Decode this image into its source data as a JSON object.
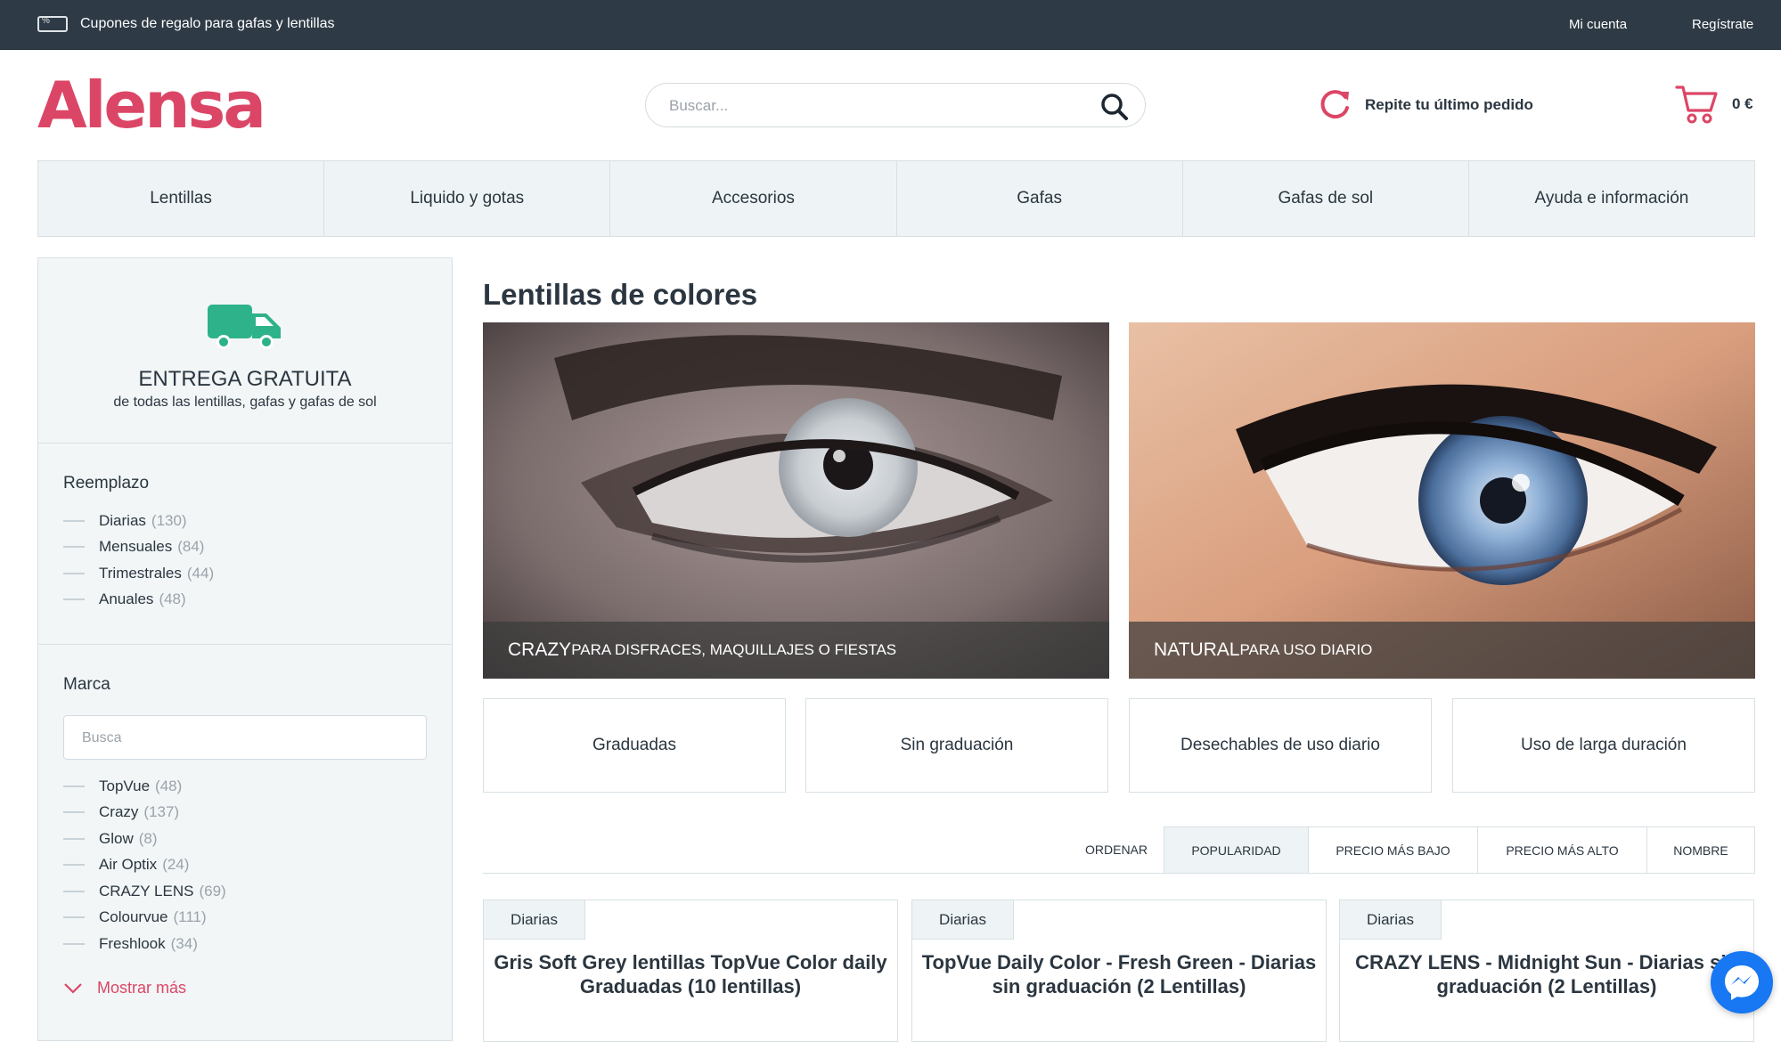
{
  "topbar": {
    "coupon_text": "Cupones de regalo para gafas y lentillas",
    "my_account": "Mi cuenta",
    "register": "Regístrate"
  },
  "header": {
    "logo": "Alensa",
    "search_placeholder": "Buscar...",
    "reorder_label": "Repite tu último pedido",
    "cart_total": "0 €"
  },
  "nav": {
    "items": [
      "Lentillas",
      "Liquido y gotas",
      "Accesorios",
      "Gafas",
      "Gafas de sol",
      "Ayuda e información"
    ]
  },
  "sidebar": {
    "delivery_title": "ENTREGA GRATUITA",
    "delivery_sub": "de todas las lentillas, gafas y gafas de sol",
    "replacement": {
      "title": "Reemplazo",
      "items": [
        {
          "label": "Diarias",
          "count": "(130)"
        },
        {
          "label": "Mensuales",
          "count": "(84)"
        },
        {
          "label": "Trimestrales",
          "count": "(44)"
        },
        {
          "label": "Anuales",
          "count": "(48)"
        }
      ]
    },
    "brand": {
      "title": "Marca",
      "search_placeholder": "Busca",
      "items": [
        {
          "label": "TopVue",
          "count": "(48)"
        },
        {
          "label": "Crazy",
          "count": "(137)"
        },
        {
          "label": "Glow",
          "count": "(8)"
        },
        {
          "label": "Air Optix",
          "count": "(24)"
        },
        {
          "label": "CRAZY LENS",
          "count": "(69)"
        },
        {
          "label": "Colourvue",
          "count": "(111)"
        },
        {
          "label": "Freshlook",
          "count": "(34)"
        }
      ],
      "show_more": "Mostrar más"
    }
  },
  "main": {
    "title": "Lentillas de colores",
    "banners": [
      {
        "main": "CRAZY",
        "sub": "PARA DISFRACES, MAQUILLAJES O FIESTAS"
      },
      {
        "main": "NATURAL",
        "sub": "PARA USO DIARIO"
      }
    ],
    "categories": [
      "Graduadas",
      "Sin graduación",
      "Desechables de uso diario",
      "Uso de larga duración"
    ],
    "sort": {
      "label": "ORDENAR",
      "options": [
        "POPULARIDAD",
        "PRECIO MÁS BAJO",
        "PRECIO MÁS ALTO",
        "NOMBRE"
      ],
      "active": "POPULARIDAD"
    },
    "products": [
      {
        "tag": "Diarias",
        "name": "Gris Soft Grey lentillas TopVue Color daily Graduadas (10 lentillas)"
      },
      {
        "tag": "Diarias",
        "name": "TopVue Daily Color - Fresh Green - Diarias sin graduación (2 Lentillas)"
      },
      {
        "tag": "Diarias",
        "name": "CRAZY LENS - Midnight Sun - Diarias sin graduación (2 Lentillas)"
      }
    ]
  },
  "colors": {
    "brand": "#dc4666",
    "topbar": "#2e3a45",
    "delivery_green": "#2eb28a",
    "messenger": "#1877f2"
  }
}
